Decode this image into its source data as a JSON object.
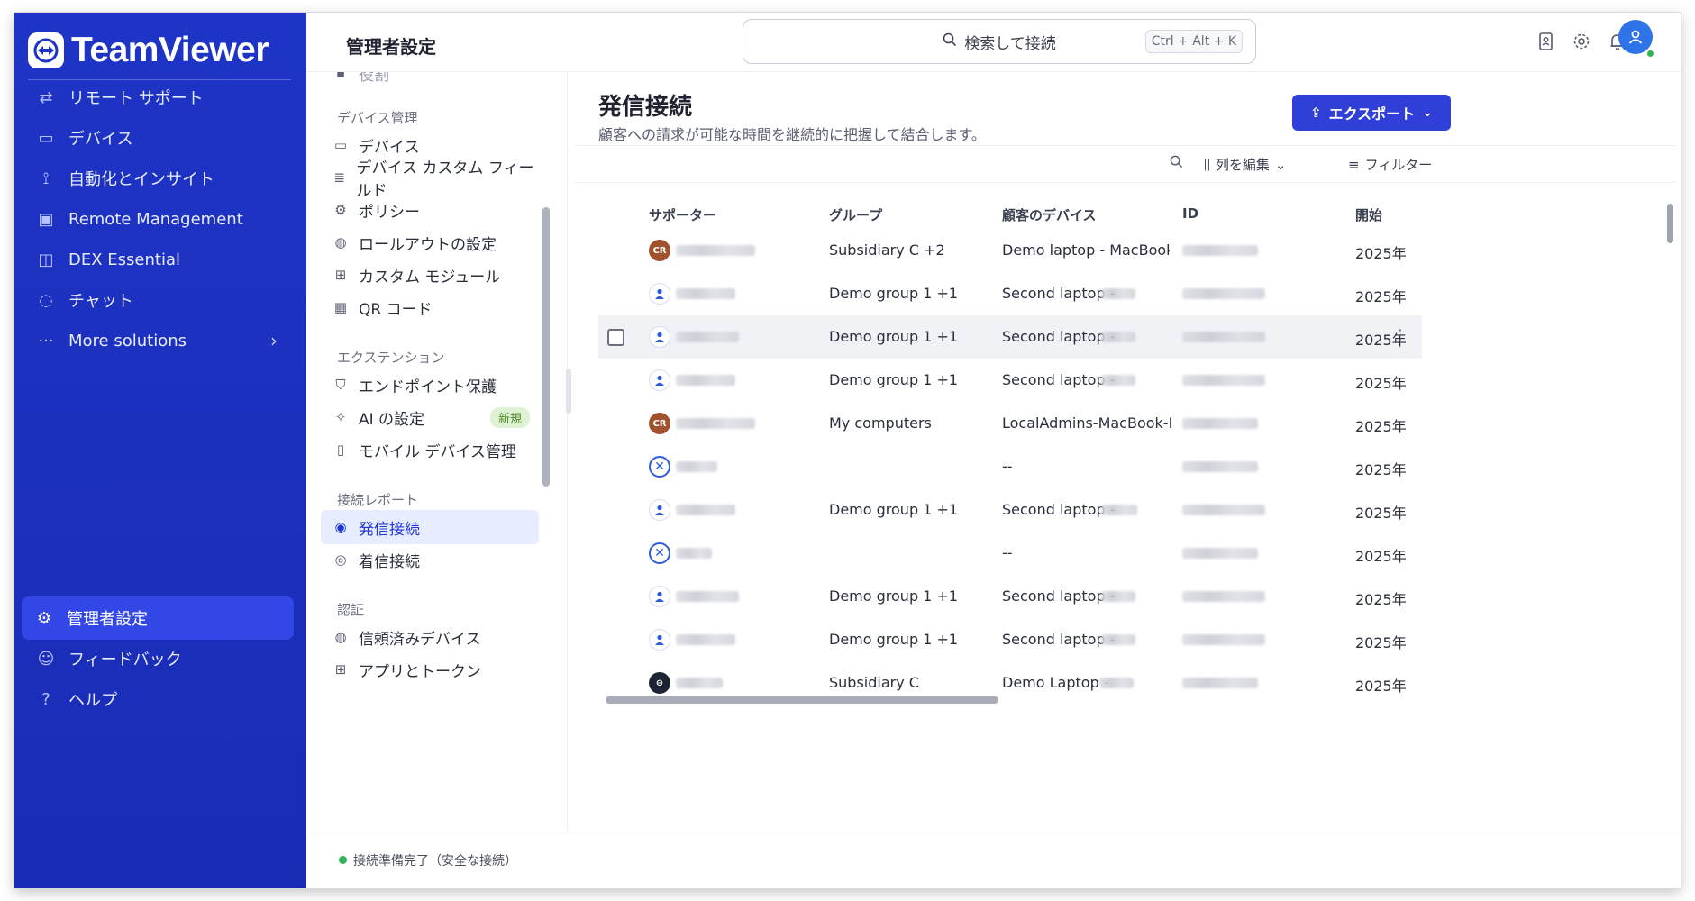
{
  "brand": {
    "name": "TeamViewer"
  },
  "sidebar": {
    "items": [
      {
        "label": "リモート サポート",
        "icon": "arrows-swap-icon"
      },
      {
        "label": "デバイス",
        "icon": "devices-icon"
      },
      {
        "label": "自動化とインサイト",
        "icon": "automation-icon"
      },
      {
        "label": "Remote Management",
        "icon": "remote-management-icon"
      },
      {
        "label": "DEX Essential",
        "icon": "dex-icon"
      },
      {
        "label": "チャット",
        "icon": "chat-icon"
      },
      {
        "label": "More solutions",
        "icon": "more-icon"
      }
    ],
    "bottom": [
      {
        "label": "管理者設定",
        "icon": "admin-settings-icon"
      },
      {
        "label": "フィードバック",
        "icon": "feedback-icon"
      },
      {
        "label": "ヘルプ",
        "icon": "help-icon"
      }
    ]
  },
  "header": {
    "title": "管理者設定",
    "search_placeholder": "検索して接続",
    "search_shortcut": "Ctrl + Alt + K"
  },
  "submenu": {
    "partial_top": "役割",
    "sections": [
      {
        "title": "デバイス管理",
        "items": [
          "デバイス",
          "デバイス カスタム フィールド",
          "ポリシー",
          "ロールアウトの設定",
          "カスタム モジュール",
          "QR コード"
        ]
      },
      {
        "title": "エクステンション",
        "items": [
          "エンドポイント保護",
          "AI の設定",
          "モバイル デバイス管理"
        ]
      },
      {
        "title": "接続レポート",
        "items": [
          "発信接続",
          "着信接続"
        ]
      },
      {
        "title": "認証",
        "items": [
          "信頼済みデバイス",
          "アプリとトークン"
        ]
      }
    ],
    "new_badge": "新規"
  },
  "content": {
    "title": "発信接続",
    "subtitle": "顧客への請求が可能な時間を継続的に把握して結合します。",
    "export_label": "エクスポート",
    "edit_columns_label": "列を編集",
    "filter_label": "フィルター"
  },
  "table": {
    "columns": [
      "サポーター",
      "グループ",
      "顧客のデバイス",
      "ID",
      "開始"
    ],
    "rows": [
      {
        "avatar": "CR",
        "type": "cr",
        "group": "Subsidiary C +2",
        "device": "Demo laptop - MacBook Air",
        "start": "2025年"
      },
      {
        "avatar": "",
        "type": "user",
        "group": "Demo group 1 +1",
        "device": "Second laptop -",
        "start": "2025年"
      },
      {
        "avatar": "",
        "type": "user",
        "group": "Demo group 1 +1",
        "device": "Second laptop -",
        "start": "2025年"
      },
      {
        "avatar": "",
        "type": "user",
        "group": "Demo group 1 +1",
        "device": "Second laptop -",
        "start": "2025年"
      },
      {
        "avatar": "CR",
        "type": "cr",
        "group": "My computers",
        "device": "LocalAdmins-MacBook-Pro.lc",
        "start": "2025年"
      },
      {
        "avatar": "",
        "type": "tv",
        "group": "",
        "device": "--",
        "start": "2025年"
      },
      {
        "avatar": "",
        "type": "user",
        "group": "Demo group 1 +1",
        "device": "Second laptop -",
        "start": "2025年"
      },
      {
        "avatar": "",
        "type": "tv",
        "group": "",
        "device": "--",
        "start": "2025年"
      },
      {
        "avatar": "",
        "type": "user",
        "group": "Demo group 1 +1",
        "device": "Second laptop -",
        "start": "2025年"
      },
      {
        "avatar": "",
        "type": "user",
        "group": "Demo group 1 +1",
        "device": "Second laptop -",
        "start": "2025年"
      },
      {
        "avatar": "",
        "type": "dark",
        "group": "Subsidiary C",
        "device": "Demo Laptop -",
        "start": "2025年"
      }
    ]
  },
  "status": {
    "text": "接続準備完了（安全な接続）"
  },
  "colors": {
    "brand_blue": "#1e34c6",
    "accent": "#2f3fd8",
    "online": "#34b352"
  }
}
